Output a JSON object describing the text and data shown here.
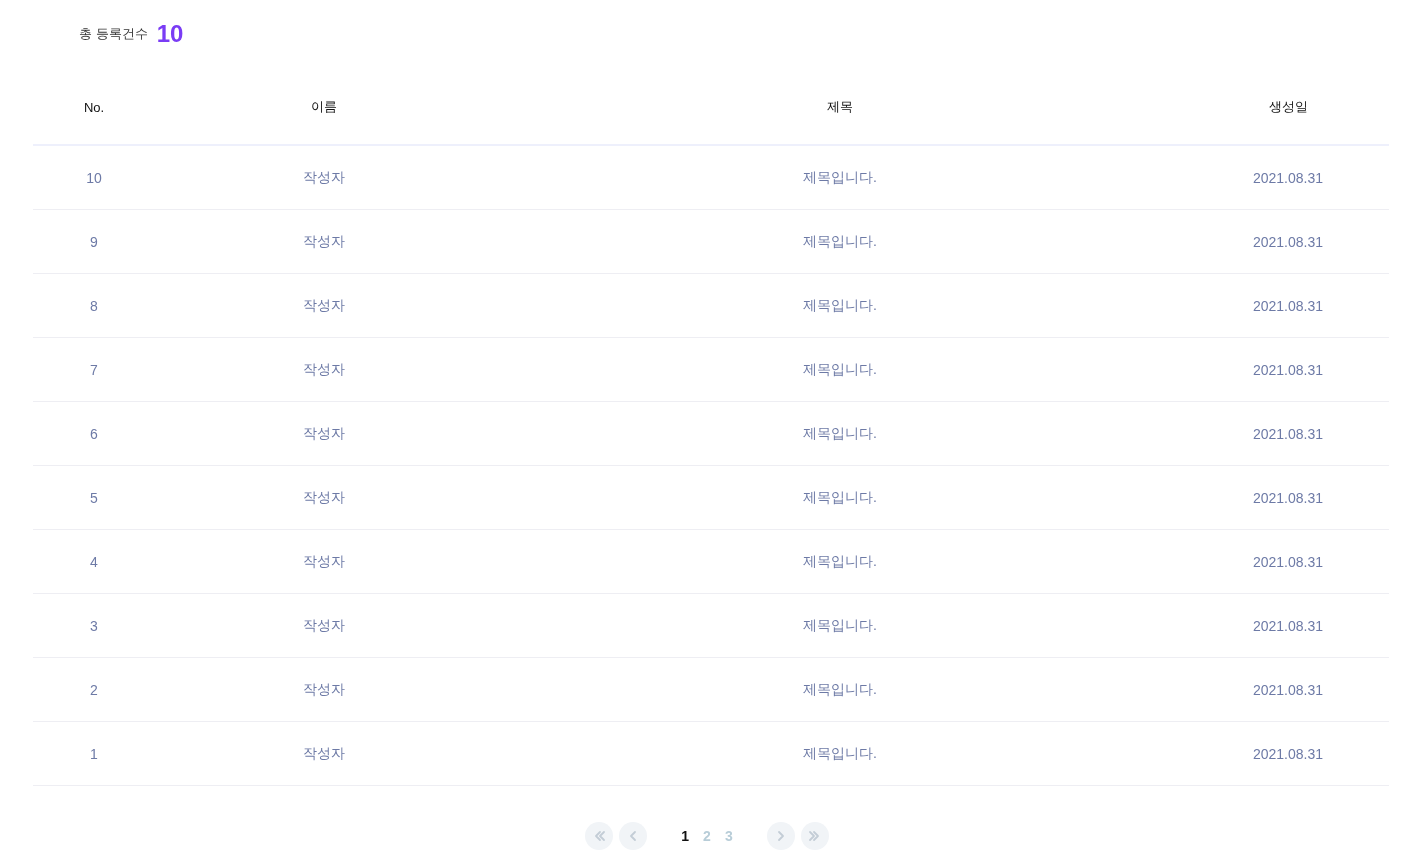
{
  "summary": {
    "label": "총 등록건수",
    "count": "10"
  },
  "table": {
    "columns": [
      "No.",
      "이름",
      "제목",
      "생성일"
    ],
    "rows": [
      [
        "10",
        "작성자",
        "제목입니다.",
        "2021.08.31"
      ],
      [
        "9",
        "작성자",
        "제목입니다.",
        "2021.08.31"
      ],
      [
        "8",
        "작성자",
        "제목입니다.",
        "2021.08.31"
      ],
      [
        "7",
        "작성자",
        "제목입니다.",
        "2021.08.31"
      ],
      [
        "6",
        "작성자",
        "제목입니다.",
        "2021.08.31"
      ],
      [
        "5",
        "작성자",
        "제목입니다.",
        "2021.08.31"
      ],
      [
        "4",
        "작성자",
        "제목입니다.",
        "2021.08.31"
      ],
      [
        "3",
        "작성자",
        "제목입니다.",
        "2021.08.31"
      ],
      [
        "2",
        "작성자",
        "제목입니다.",
        "2021.08.31"
      ],
      [
        "1",
        "작성자",
        "제목입니다.",
        "2021.08.31"
      ]
    ]
  },
  "pagination": {
    "pages": [
      {
        "label": "1",
        "selected": true
      },
      {
        "label": "2",
        "selected": false
      },
      {
        "label": "3",
        "selected": false
      }
    ]
  }
}
